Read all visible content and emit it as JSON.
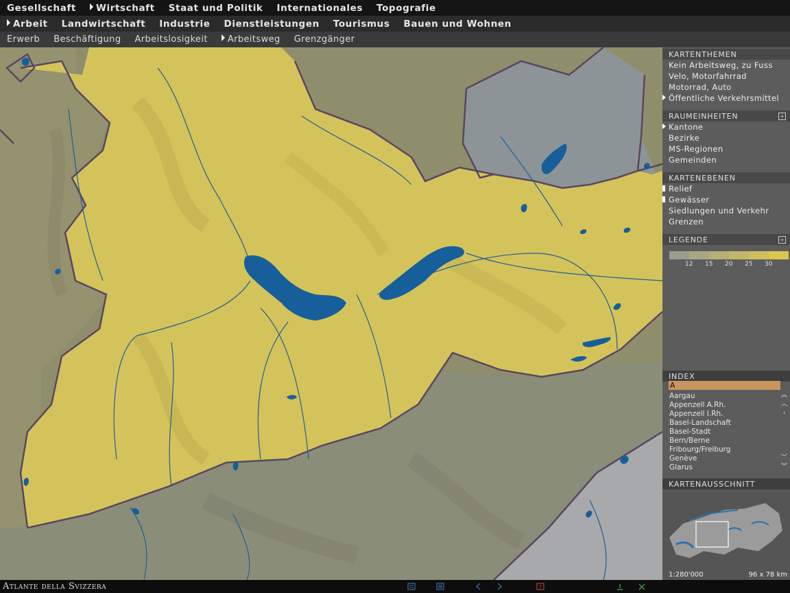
{
  "nav_main": [
    {
      "label": "Gesellschaft",
      "active": false
    },
    {
      "label": "Wirtschaft",
      "active": true
    },
    {
      "label": "Staat und Politik",
      "active": false
    },
    {
      "label": "Internationales",
      "active": false
    },
    {
      "label": "Topografie",
      "active": false
    }
  ],
  "nav_sub": [
    {
      "label": "Arbeit",
      "active": true
    },
    {
      "label": "Landwirtschaft",
      "active": false
    },
    {
      "label": "Industrie",
      "active": false
    },
    {
      "label": "Dienstleistungen",
      "active": false
    },
    {
      "label": "Tourismus",
      "active": false
    },
    {
      "label": "Bauen und Wohnen",
      "active": false
    }
  ],
  "nav_topic": [
    {
      "label": "Erwerb",
      "active": false
    },
    {
      "label": "Beschäftigung",
      "active": false
    },
    {
      "label": "Arbeitslosigkeit",
      "active": false
    },
    {
      "label": "Arbeitsweg",
      "active": true
    },
    {
      "label": "Grenzgänger",
      "active": false
    }
  ],
  "panel": {
    "kartenthemen": {
      "title": "KARTENTHEMEN",
      "items": [
        "Kein Arbeitsweg, zu Fuss",
        "Velo, Motorfahrrad",
        "Motorrad, Auto",
        "Öffentliche Verkehrsmittel"
      ],
      "selected_index": 3
    },
    "raumeinheiten": {
      "title": "RAUMEINHEITEN",
      "items": [
        "Kantone",
        "Bezirke",
        "MS-Regionen",
        "Gemeinden"
      ],
      "selected_index": 0
    },
    "kartenebenen": {
      "title": "KARTENEBENEN",
      "items": [
        "Relief",
        "Gewässer",
        "Siedlungen und Verkehr",
        "Grenzen"
      ],
      "checked": [
        true,
        true,
        false,
        false
      ]
    },
    "legende": {
      "title": "LEGENDE",
      "colors": [
        "#9a9d8c",
        "#a7a883",
        "#b4af78",
        "#c2b66a",
        "#d0bd5d",
        "#ddc64f"
      ],
      "ticks": [
        "12",
        "15",
        "20",
        "25",
        "30"
      ]
    },
    "index": {
      "title": "INDEX",
      "search_value": "A",
      "items": [
        "Aargau",
        "Appenzell A.Rh.",
        "Appenzell I.Rh.",
        "Basel-Landschaft",
        "Basel-Stadt",
        "Bern/Berne",
        "Fribourg/Freiburg",
        "Genève",
        "Glarus"
      ]
    },
    "kartenausschnitt": {
      "title": "KARTENAUSSCHNITT",
      "scale": "1:280'000",
      "size": "96 x 78 km"
    }
  },
  "footer": {
    "brand": "Atlante della Svizzera",
    "icons": [
      "document-icon",
      "list-icon",
      "back-arrow-icon",
      "forward-arrow-icon",
      "help-icon",
      "info-icon",
      "close-icon"
    ]
  },
  "colors": {
    "accent_orange": "#c8965e",
    "map_yellow": "#d4c35b",
    "water_blue": "#165f9a",
    "border_purple": "#5a4660"
  }
}
